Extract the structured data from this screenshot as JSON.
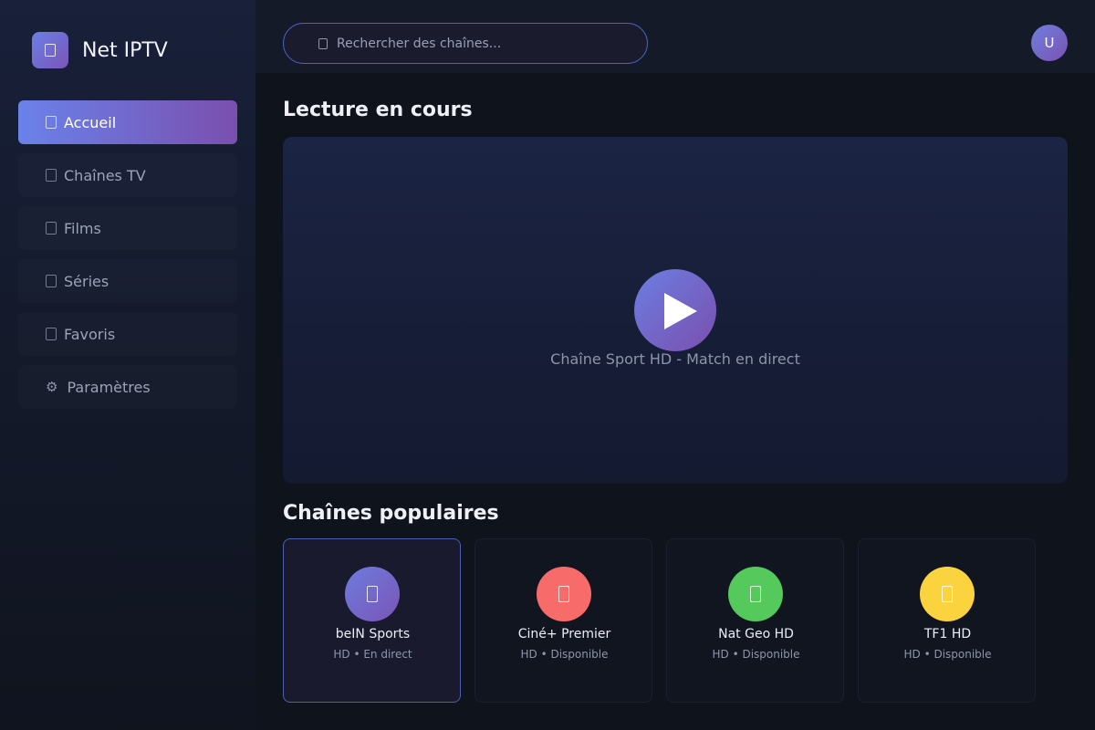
{
  "app": {
    "title": "Net IPTV"
  },
  "sidebar": {
    "items": [
      {
        "label": "Accueil",
        "icon": "home-icon",
        "active": true
      },
      {
        "label": "Chaînes TV",
        "icon": "tv-icon",
        "active": false
      },
      {
        "label": "Films",
        "icon": "film-icon",
        "active": false
      },
      {
        "label": "Séries",
        "icon": "series-icon",
        "active": false
      },
      {
        "label": "Favoris",
        "icon": "star-icon",
        "active": false
      },
      {
        "label": "Paramètres",
        "icon": "gear-icon",
        "active": false
      }
    ]
  },
  "header": {
    "search_placeholder": "Rechercher des chaînes...",
    "avatar_initial": "U"
  },
  "main": {
    "now_playing_title": "Lecture en cours",
    "now_playing_caption": "Chaîne Sport HD - Match en direct",
    "popular_title": "Chaînes populaires",
    "channels": [
      {
        "name": "beIN Sports",
        "meta": "HD • En direct",
        "color": "#6b71d8",
        "selected": true
      },
      {
        "name": "Ciné+ Premier",
        "meta": "HD • Disponible",
        "color": "#f76b6b",
        "selected": false
      },
      {
        "name": "Nat Geo HD",
        "meta": "HD • Disponible",
        "color": "#55c95c",
        "selected": false
      },
      {
        "name": "TF1 HD",
        "meta": "HD • Disponible",
        "color": "#fbd33f",
        "selected": false
      }
    ]
  },
  "colors": {
    "accent_start": "#6a82ea",
    "accent_end": "#7a4fae",
    "background": "#0f131c"
  }
}
